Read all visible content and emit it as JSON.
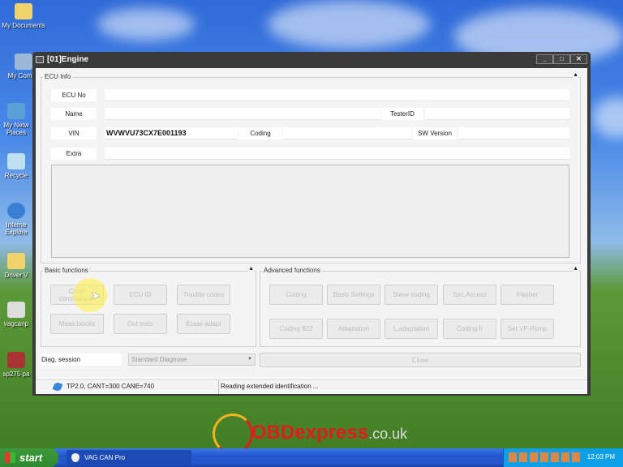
{
  "desktop": {
    "icons": [
      "My Documents",
      "My Compu",
      "My Netw Places",
      "Recycle",
      "Interne Explore",
      "Driver V",
      "vagcanp",
      "sp275 pa"
    ]
  },
  "window": {
    "title": "[01]Engine",
    "buttons": [
      "_",
      "□",
      "✕"
    ]
  },
  "ecu_info": {
    "title": "ECU Info",
    "ecu_no_label": "ECU No",
    "ecu_no": "",
    "name_label": "Name",
    "name": "",
    "testerid_label": "TesterID",
    "testerid": "",
    "vin_label": "VIN",
    "vin": "WVWVU73CX7E001193",
    "coding_label": "Coding",
    "coding": "",
    "sw_version_label": "SW Version",
    "sw_version": "",
    "extra_label": "Extra",
    "extra": ""
  },
  "basic": {
    "title": "Basic functions",
    "buttons": [
      "Close communicati",
      "ECU ID",
      "Trouble codes",
      "Meas.blocks",
      "Out.tests",
      "Erase adapt"
    ]
  },
  "advanced": {
    "title": "Advanced functions",
    "buttons": [
      "Coding",
      "Basic Settings",
      "Slave coding",
      "Sec.Access",
      "Flasher",
      "Coding $22",
      "Adaptation",
      "L.adaptation",
      "Coding II",
      "Set VP-Pump"
    ]
  },
  "diag": {
    "label": "Diag. session",
    "selected": "Standard Diagnose",
    "close_label": "Close"
  },
  "status": {
    "protocol": "TP2.0, CANT=300 CANE=740",
    "message": "Reading extended identification ..."
  },
  "watermark": {
    "text": "OBDexpress",
    "suffix": ".co.uk"
  },
  "taskbar": {
    "start": "start",
    "task": "VAG CAN Pro",
    "clock": "12:03 PM"
  }
}
